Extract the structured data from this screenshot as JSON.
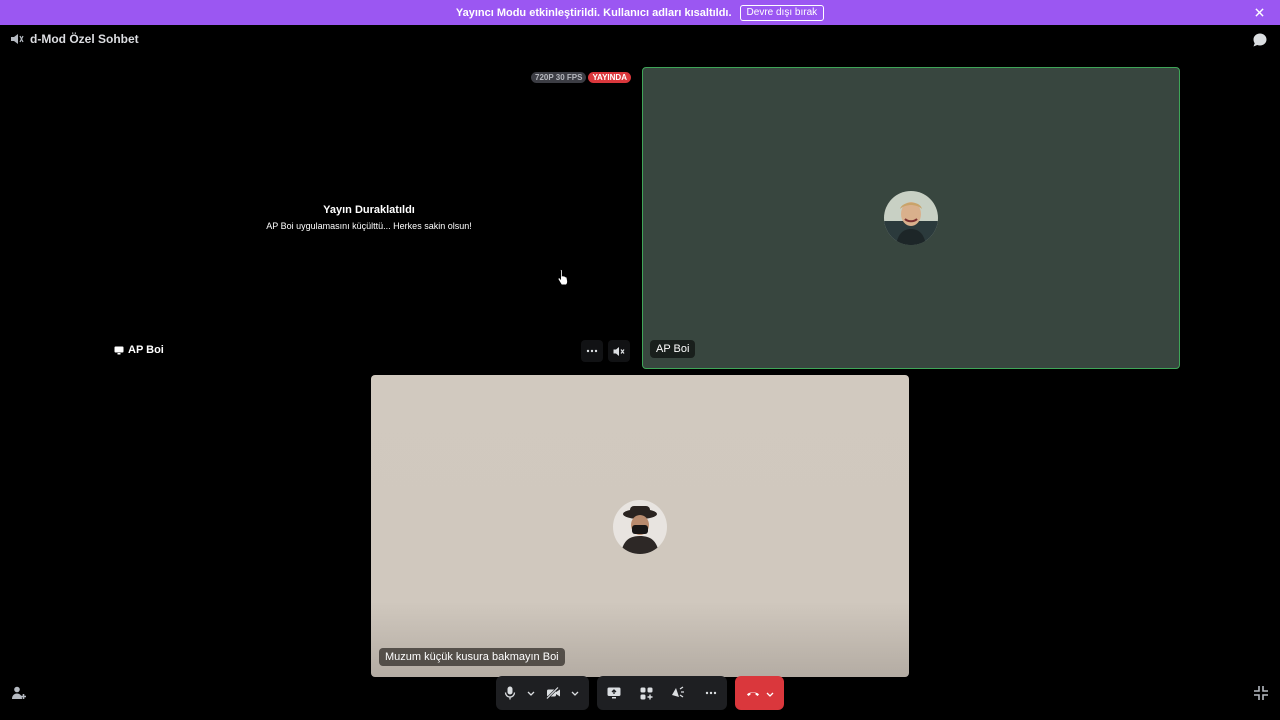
{
  "notice": {
    "text": "Yayıncı Modu etkinleştirildi. Kullanıcı adları kısaltıldı.",
    "disable_label": "Devre dışı bırak",
    "close_icon": "close-icon"
  },
  "header": {
    "title": "d-Mod Özel Sohbet",
    "speaker_icon": "speaker-icon",
    "chat_icon": "chat-bubble-icon"
  },
  "stream": {
    "quality_badge": "720P 30 FPS",
    "live_badge": "YAYINDA",
    "paused_title": "Yayın Duraklatıldı",
    "paused_subtitle": "AP Boi uygulamasını küçülttü... Herkes sakin olsun!",
    "streamer_name": "AP Boi",
    "more_icon": "more-horizontal-icon",
    "mute_icon": "volume-mute-icon"
  },
  "tiles": {
    "top_user": "AP Boi",
    "bottom_user": "Muzum küçük kusura bakmayın Boi"
  },
  "controls": {
    "items": [
      "microphone-icon",
      "chevron-down-icon",
      "camera-off-icon",
      "chevron-down-icon",
      "screen-share-icon",
      "activities-icon",
      "soundboard-icon",
      "more-horizontal-icon",
      "hang-up-icon",
      "chevron-down-icon"
    ]
  },
  "colors": {
    "notice_bg": "#9b57f2",
    "live_badge": "#da373c",
    "speaking_border": "#3fa558",
    "hangup": "#da373c"
  }
}
